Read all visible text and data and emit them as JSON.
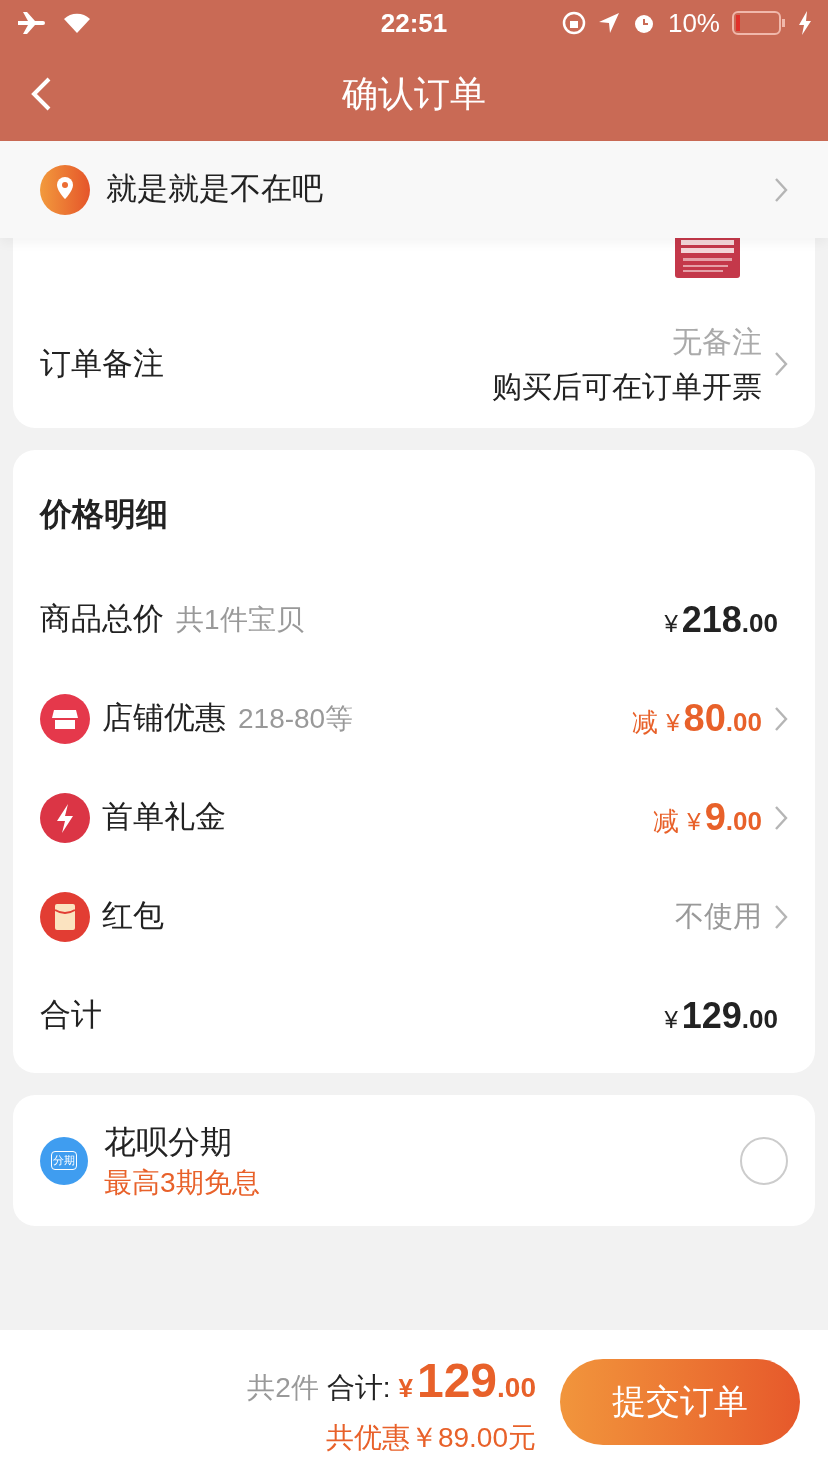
{
  "status_bar": {
    "time": "22:51",
    "battery": "10%"
  },
  "nav": {
    "title": "确认订单"
  },
  "address": {
    "text": "就是就是不在吧"
  },
  "remark": {
    "label": "订单备注",
    "value": "无备注",
    "note": "购买后可在订单开票"
  },
  "price": {
    "title": "价格明细",
    "rows": [
      {
        "kind": "amount",
        "label": "商品总价",
        "sub": "共1件宝贝",
        "currency": "¥",
        "integer": "218",
        "decimals": ".00"
      },
      {
        "kind": "discount",
        "label": "店铺优惠",
        "sub": "218-80等",
        "prefix": "减",
        "currency": "¥",
        "integer": "80",
        "decimals": ".00"
      },
      {
        "kind": "discount",
        "label": "首单礼金",
        "prefix": "减",
        "currency": "¥",
        "integer": "9",
        "decimals": ".00"
      },
      {
        "kind": "option",
        "label": "红包",
        "value": "不使用"
      },
      {
        "kind": "amount",
        "label": "合计",
        "currency": "¥",
        "integer": "129",
        "decimals": ".00"
      }
    ]
  },
  "installment": {
    "title": "花呗分期",
    "subtitle": "最高3期免息",
    "icon_text": "分期",
    "selected": false
  },
  "footer": {
    "count": "共2件",
    "label": "合计:",
    "currency": "¥",
    "integer": "129",
    "decimals": ".00",
    "saving": "共优惠￥89.00元",
    "button": "提交订单"
  }
}
